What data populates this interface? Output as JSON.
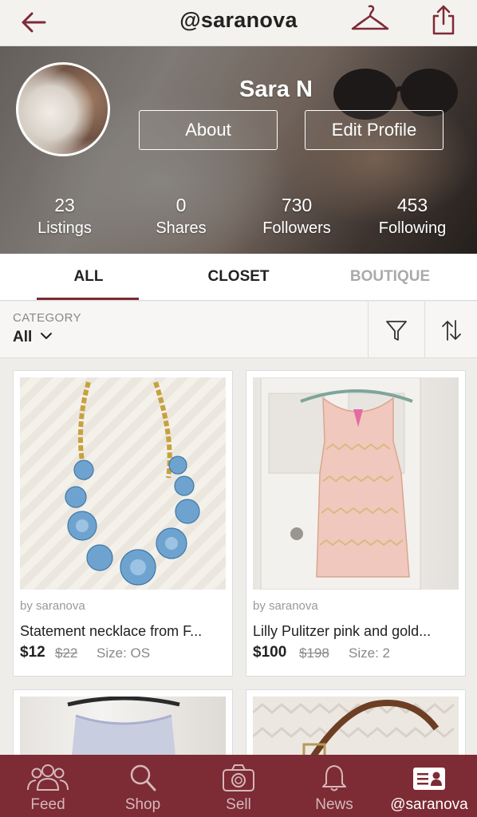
{
  "header": {
    "title": "@saranova"
  },
  "profile": {
    "name": "Sara N",
    "about_label": "About",
    "edit_label": "Edit Profile",
    "stats": [
      {
        "value": "23",
        "label": "Listings"
      },
      {
        "value": "0",
        "label": "Shares"
      },
      {
        "value": "730",
        "label": "Followers"
      },
      {
        "value": "453",
        "label": "Following"
      }
    ]
  },
  "tabs": [
    {
      "label": "ALL",
      "active": true
    },
    {
      "label": "CLOSET",
      "active": false
    },
    {
      "label": "BOUTIQUE",
      "active": false
    }
  ],
  "filter": {
    "category_label": "CATEGORY",
    "category_value": "All"
  },
  "listings": [
    {
      "by": "by saranova",
      "title": "Statement necklace from F...",
      "price": "$12",
      "original_price": "$22",
      "size": "Size: OS"
    },
    {
      "by": "by saranova",
      "title": "Lilly Pulitzer pink and gold...",
      "price": "$100",
      "original_price": "$198",
      "size": "Size: 2"
    }
  ],
  "bottom_nav": [
    {
      "label": "Feed",
      "icon": "people-icon",
      "active": false
    },
    {
      "label": "Shop",
      "icon": "search-icon",
      "active": false
    },
    {
      "label": "Sell",
      "icon": "camera-icon",
      "active": false
    },
    {
      "label": "News",
      "icon": "bell-icon",
      "active": false
    },
    {
      "label": "@saranova",
      "icon": "profile-card-icon",
      "active": true
    }
  ],
  "colors": {
    "brand": "#7d2b34",
    "accent_underline": "#7e2a35",
    "muted_tab": "#aaaaaa"
  }
}
